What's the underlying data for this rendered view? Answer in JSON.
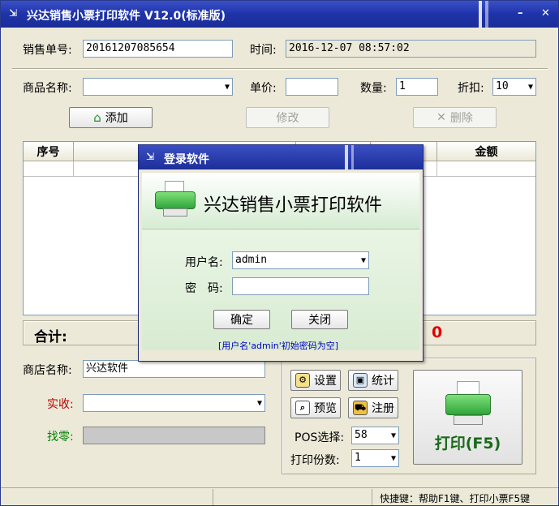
{
  "window": {
    "title": "兴达销售小票打印软件 V12.0(标准版)",
    "minimize_glyph": "–",
    "close_glyph": "✕",
    "sys_glyph": "⇲"
  },
  "sale": {
    "order_label": "销售单号:",
    "order_value": "20161207085654",
    "time_label": "时间:",
    "time_value": "2016-12-07 08:57:02",
    "product_label": "商品名称:",
    "product_value": "",
    "price_label": "单价:",
    "price_value": "",
    "qty_label": "数量:",
    "qty_value": "1",
    "discount_label": "折扣:",
    "discount_value": "10"
  },
  "actions": {
    "add_label": "添加",
    "edit_label": "修改",
    "delete_label": "删除"
  },
  "grid": {
    "col_seq": "序号",
    "col_amount": "金额"
  },
  "totals": {
    "total_label": "合计:",
    "total_value": "0"
  },
  "shop": {
    "shop_label": "商店名称:",
    "shop_value": "兴达软件",
    "received_label": "实收:",
    "received_value": "",
    "change_label": "找零:",
    "change_value": ""
  },
  "panel": {
    "settings_label": "设置",
    "stats_label": "统计",
    "preview_label": "预览",
    "register_label": "注册",
    "pos_label": "POS选择:",
    "pos_value": "58",
    "copies_label": "打印份数:",
    "copies_value": "1",
    "print_label": "打印(F5)"
  },
  "status": {
    "shortcut_text": "快捷键：帮助F1键、打印小票F5键"
  },
  "login": {
    "title": "登录软件",
    "banner_text": "兴达销售小票打印软件",
    "username_label": "用户名:",
    "username_value": "admin",
    "password_label": "密　码:",
    "password_value": "",
    "ok_label": "确定",
    "close_label": "关闭",
    "hint": "[用户名'admin'初始密码为空]"
  },
  "colors": {
    "title_blue": "#1e33a8",
    "total_red": "#e00000",
    "received_red": "#c00000",
    "change_green": "#008000",
    "print_green": "#1a6a1a",
    "hint_blue": "#0000c0"
  }
}
